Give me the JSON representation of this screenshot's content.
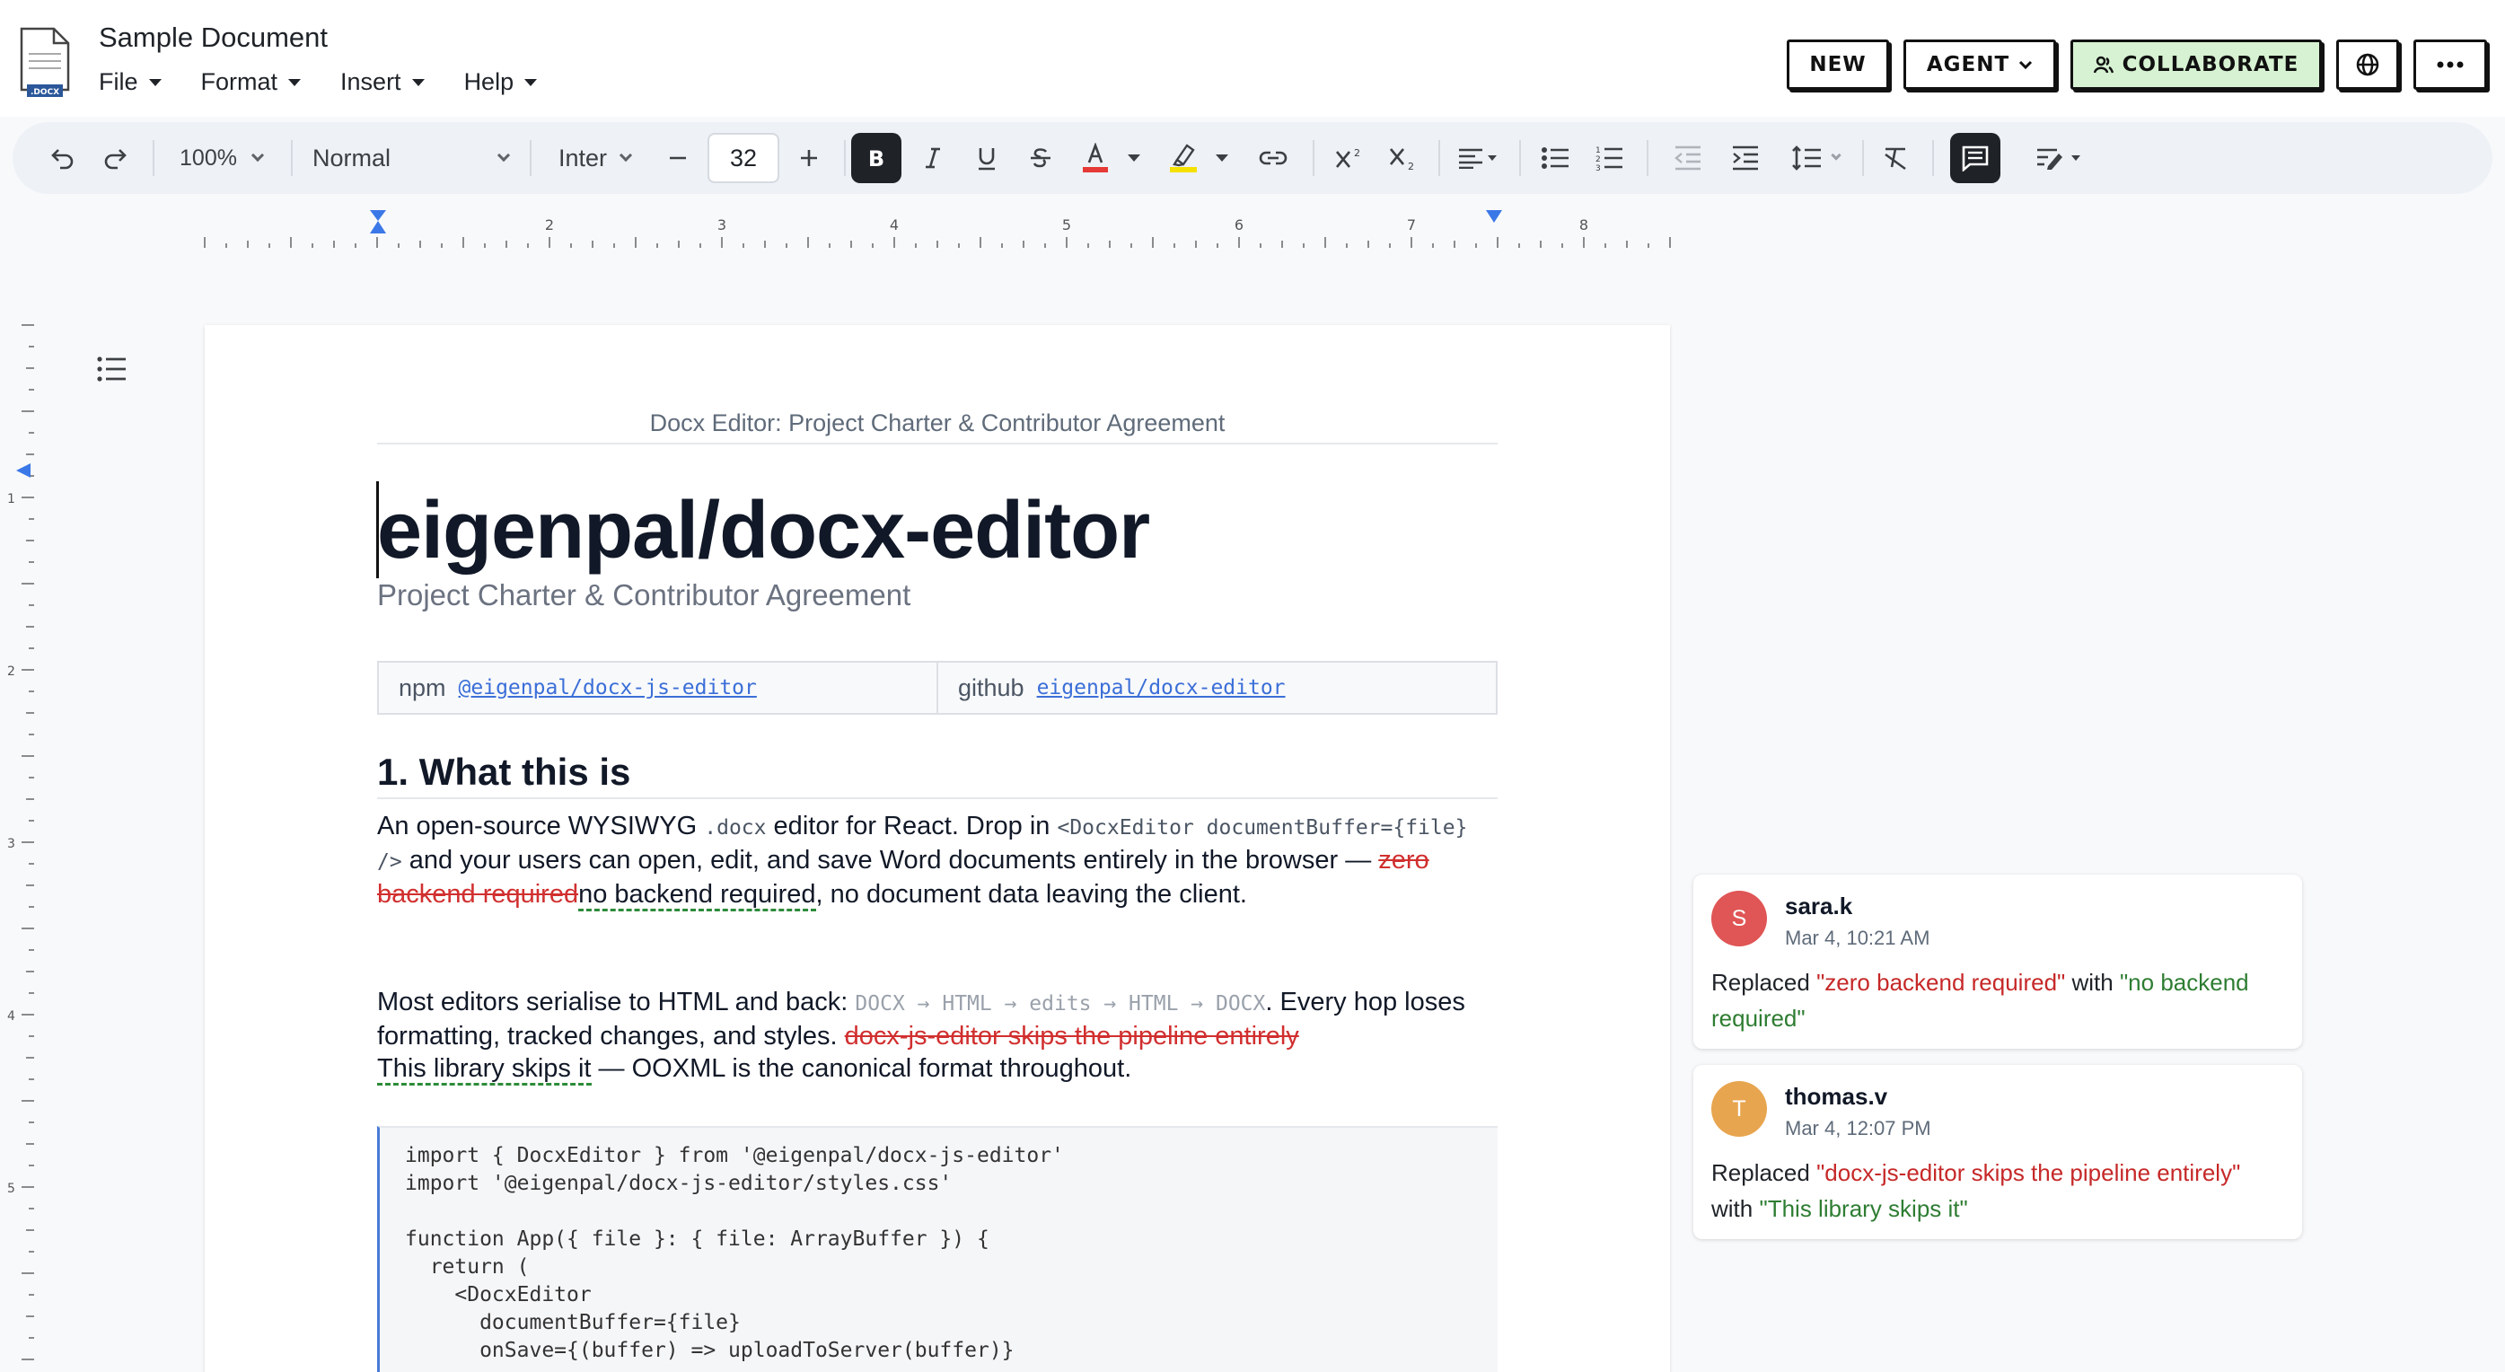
{
  "app": {
    "doc_title": "Sample Document",
    "doc_badge": ".DOCX",
    "menus": [
      "File",
      "Format",
      "Insert",
      "Help"
    ]
  },
  "header_actions": {
    "new": "NEW",
    "agent": "AGENT",
    "collaborate": "COLLABORATE"
  },
  "toolbar": {
    "zoom": "100%",
    "style": "Normal",
    "font": "Inter",
    "font_size": "32",
    "colors": {
      "text_color_bar": "#e53935",
      "highlight_bar": "#f5e100"
    }
  },
  "ruler": {
    "h_labels": [
      "2",
      "3",
      "4",
      "5",
      "6",
      "7",
      "8"
    ],
    "v_labels": [
      "1",
      "2",
      "3",
      "4",
      "5"
    ]
  },
  "document": {
    "header_text": "Docx Editor: Project Charter & Contributor Agreement",
    "title": "eigenpal/docx-editor",
    "subtitle": "Project Charter & Contributor Agreement",
    "links": [
      {
        "label": "npm",
        "value": "@eigenpal/docx-js-editor"
      },
      {
        "label": "github",
        "value": "eigenpal/docx-editor"
      }
    ],
    "section_heading": "1.  What this is",
    "para1": {
      "t1": "An open-source WYSIWYG ",
      "c1": ".docx",
      "t2": " editor for React. Drop in ",
      "c2": "<DocxEditor documentBuffer={file} />",
      "t3": " and your users can open, edit, and save Word documents entirely in the browser — ",
      "deleted": "zero backend required",
      "inserted": "no backend required",
      "t4": ", no document data leaving the client."
    },
    "para2": {
      "t1": "Most editors serialise to HTML and back: ",
      "c1": "DOCX → HTML → edits → HTML → DOCX",
      "t2": ". Every hop loses formatting, tracked changes, and styles. ",
      "deleted": "docx-js-editor skips the pipeline entirely",
      "inserted": "This library skips it",
      "t3": " — OOXML is the canonical format throughout."
    },
    "code_lines": [
      "import { DocxEditor } from '@eigenpal/docx-js-editor'",
      "import '@eigenpal/docx-js-editor/styles.css'",
      "",
      "function App({ file }: { file: ArrayBuffer }) {",
      "  return (",
      "    <DocxEditor",
      "      documentBuffer={file}",
      "      onSave={(buffer) => uploadToServer(buffer)}"
    ]
  },
  "comments": [
    {
      "initial": "S",
      "author": "sara.k",
      "time": "Mar 4, 10:21 AM",
      "avatar_color": "#e05555",
      "prefix": "Replaced ",
      "old": "\"zero backend required\"",
      "mid": " with ",
      "new": "\"no backend required\""
    },
    {
      "initial": "T",
      "author": "thomas.v",
      "time": "Mar 4, 12:07 PM",
      "avatar_color": "#e8a54f",
      "prefix": "Replaced ",
      "old": "\"docx-js-editor skips the pipeline entirely\"",
      "mid": " with ",
      "new": "\"This library skips it\""
    }
  ]
}
